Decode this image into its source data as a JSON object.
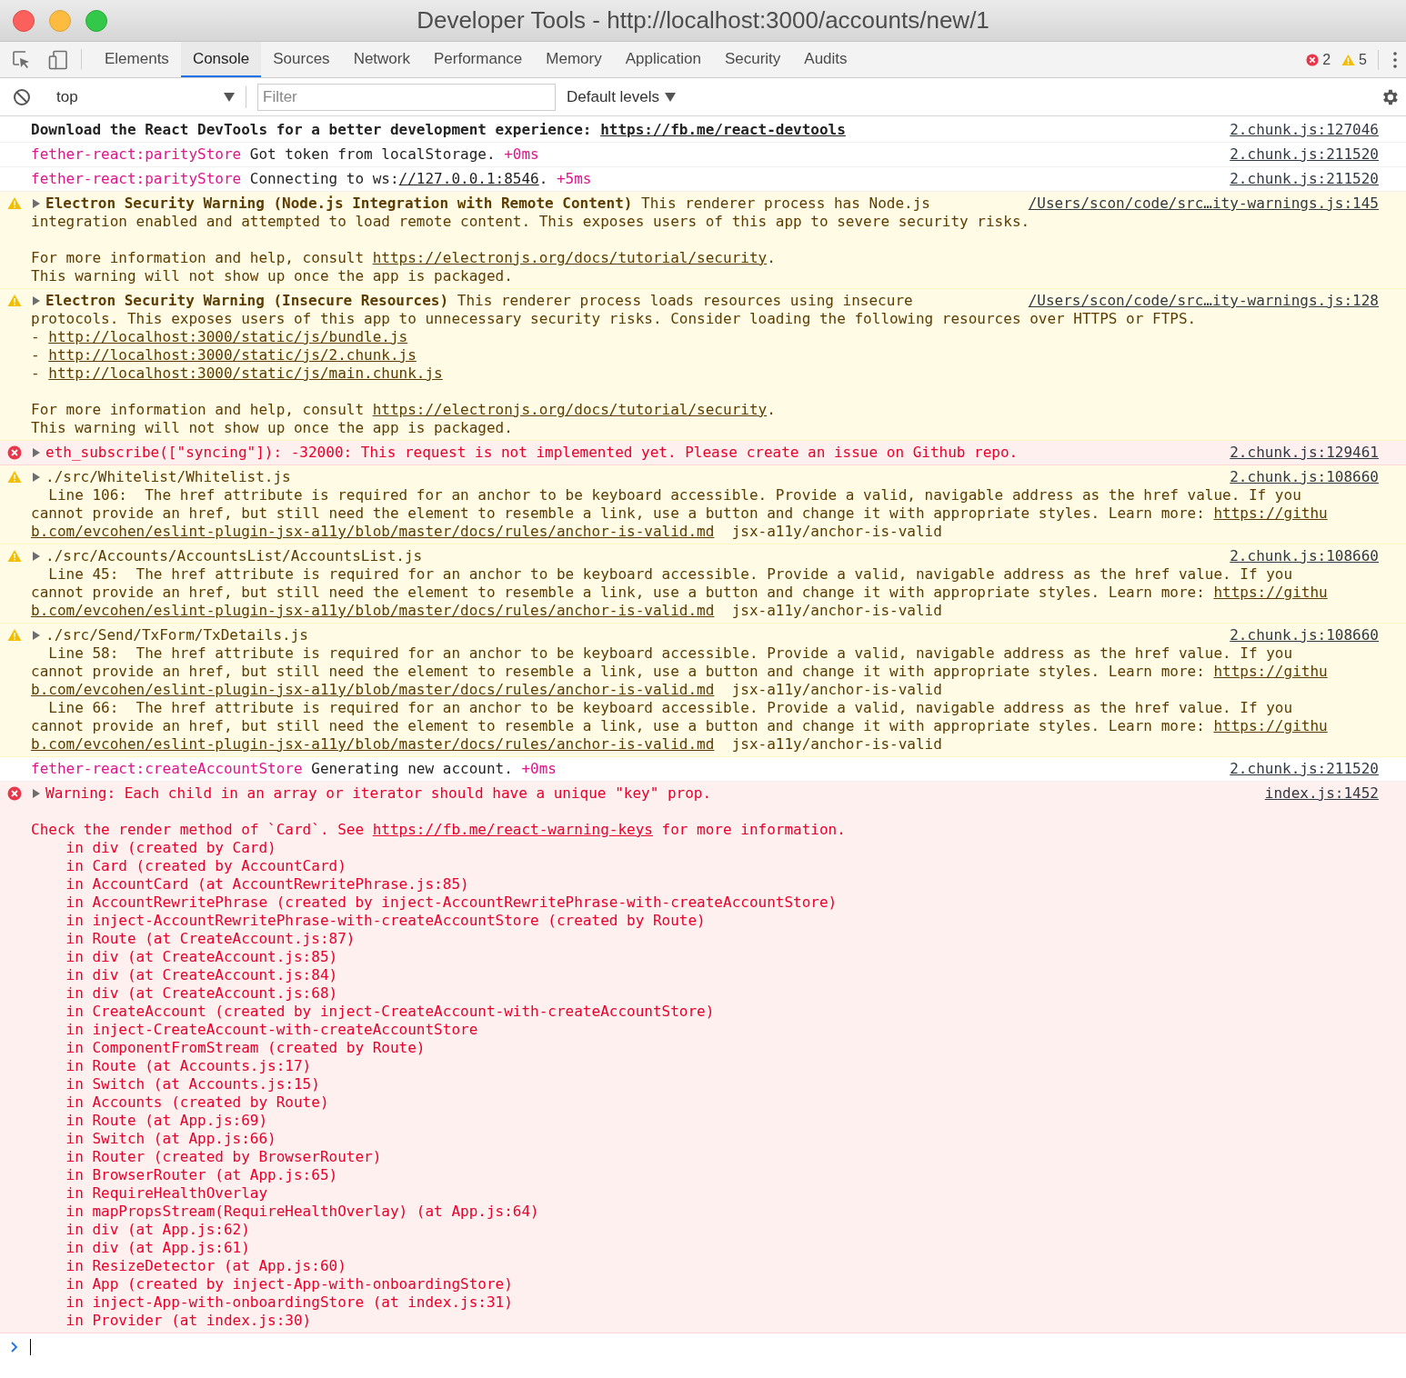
{
  "window": {
    "title": "Developer Tools - http://localhost:3000/accounts/new/1"
  },
  "tabs": [
    {
      "label": "Elements",
      "selected": false
    },
    {
      "label": "Console",
      "selected": true
    },
    {
      "label": "Sources",
      "selected": false
    },
    {
      "label": "Network",
      "selected": false
    },
    {
      "label": "Performance",
      "selected": false
    },
    {
      "label": "Memory",
      "selected": false
    },
    {
      "label": "Application",
      "selected": false
    },
    {
      "label": "Security",
      "selected": false
    },
    {
      "label": "Audits",
      "selected": false
    }
  ],
  "counts": {
    "errors": "2",
    "warnings": "5"
  },
  "filter_bar": {
    "context": "top",
    "filter_placeholder": "Filter",
    "levels": "Default levels"
  },
  "messages": [
    {
      "kind": "log",
      "source": "2.chunk.js:127046",
      "paragraphs": [
        [
          [
            {
              "kind": "bold",
              "text": "Download the React DevTools for a better development experience: "
            },
            {
              "kind": "bold-link",
              "text": "https://fb.me/react-devtools"
            }
          ]
        ]
      ]
    },
    {
      "kind": "log",
      "source": "2.chunk.js:211520",
      "paragraphs": [
        [
          [
            {
              "kind": "accent",
              "text": "fether-react:parityStore"
            },
            {
              "kind": "plain",
              "text": " Got token from localStorage. "
            },
            {
              "kind": "accent",
              "text": "+0ms"
            }
          ]
        ]
      ]
    },
    {
      "kind": "log",
      "source": "2.chunk.js:211520",
      "paragraphs": [
        [
          [
            {
              "kind": "accent",
              "text": "fether-react:parityStore"
            },
            {
              "kind": "plain",
              "text": " Connecting to ws:"
            },
            {
              "kind": "link",
              "text": "//127.0.0.1:8546"
            },
            {
              "kind": "plain",
              "text": ". "
            },
            {
              "kind": "accent",
              "text": "+5ms"
            }
          ]
        ]
      ]
    },
    {
      "kind": "warning",
      "expanded": false,
      "source": "/Users/scon/code/src…ity-warnings.js:145",
      "paragraphs": [
        [
          [
            {
              "kind": "bold",
              "text": "Electron Security Warning (Node.js Integration with Remote Content)"
            },
            {
              "kind": "plain",
              "text": " This renderer process has Node.js"
            }
          ],
          "integration enabled and attempted to load remote content. This exposes users of this app to severe security risks."
        ],
        [
          [
            {
              "kind": "plain",
              "text": "For more information and help, consult "
            },
            {
              "kind": "link",
              "text": "https://electronjs.org/docs/tutorial/security"
            },
            {
              "kind": "plain",
              "text": "."
            }
          ],
          "This warning will not show up once the app is packaged."
        ]
      ]
    },
    {
      "kind": "warning",
      "expanded": false,
      "source": "/Users/scon/code/src…ity-warnings.js:128",
      "paragraphs": [
        [
          [
            {
              "kind": "bold",
              "text": "Electron Security Warning (Insecure Resources)"
            },
            {
              "kind": "plain",
              "text": " This renderer process loads resources using insecure"
            }
          ],
          "protocols. This exposes users of this app to unnecessary security risks. Consider loading the following resources over HTTPS or FTPS.",
          [
            {
              "kind": "plain",
              "text": "- "
            },
            {
              "kind": "link",
              "text": "http://localhost:3000/static/js/bundle.js"
            }
          ],
          [
            {
              "kind": "plain",
              "text": "- "
            },
            {
              "kind": "link",
              "text": "http://localhost:3000/static/js/2.chunk.js"
            }
          ],
          [
            {
              "kind": "plain",
              "text": "- "
            },
            {
              "kind": "link",
              "text": "http://localhost:3000/static/js/main.chunk.js"
            }
          ]
        ],
        [
          [
            {
              "kind": "plain",
              "text": "For more information and help, consult "
            },
            {
              "kind": "link",
              "text": "https://electronjs.org/docs/tutorial/security"
            },
            {
              "kind": "plain",
              "text": "."
            }
          ],
          "This warning will not show up once the app is packaged."
        ]
      ]
    },
    {
      "kind": "error",
      "expanded": false,
      "source": "2.chunk.js:129461",
      "paragraphs": [
        [
          "eth_subscribe([\"syncing\"]): -32000: This request is not implemented yet. Please create an issue on Github repo."
        ]
      ]
    },
    {
      "kind": "warning",
      "expanded": false,
      "source": "2.chunk.js:108660",
      "paragraphs": [
        [
          "./src/Whitelist/Whitelist.js",
          "  Line 106:  The href attribute is required for an anchor to be keyboard accessible. Provide a valid, navigable address as the href value. If you",
          [
            {
              "kind": "plain",
              "text": "cannot provide an href, but still need the element to resemble a link, use a button and change it with appropriate styles. Learn more: "
            },
            {
              "kind": "link",
              "text": "https://githu"
            }
          ],
          [
            {
              "kind": "link",
              "text": "b.com/evcohen/eslint-plugin-jsx-a11y/blob/master/docs/rules/anchor-is-valid.md"
            },
            {
              "kind": "plain",
              "text": "  jsx-a11y/anchor-is-valid"
            }
          ]
        ]
      ]
    },
    {
      "kind": "warning",
      "expanded": false,
      "source": "2.chunk.js:108660",
      "paragraphs": [
        [
          "./src/Accounts/AccountsList/AccountsList.js",
          "  Line 45:  The href attribute is required for an anchor to be keyboard accessible. Provide a valid, navigable address as the href value. If you",
          [
            {
              "kind": "plain",
              "text": "cannot provide an href, but still need the element to resemble a link, use a button and change it with appropriate styles. Learn more: "
            },
            {
              "kind": "link",
              "text": "https://githu"
            }
          ],
          [
            {
              "kind": "link",
              "text": "b.com/evcohen/eslint-plugin-jsx-a11y/blob/master/docs/rules/anchor-is-valid.md"
            },
            {
              "kind": "plain",
              "text": "  jsx-a11y/anchor-is-valid"
            }
          ]
        ]
      ]
    },
    {
      "kind": "warning",
      "expanded": false,
      "source": "2.chunk.js:108660",
      "paragraphs": [
        [
          "./src/Send/TxForm/TxDetails.js",
          "  Line 58:  The href attribute is required for an anchor to be keyboard accessible. Provide a valid, navigable address as the href value. If you",
          [
            {
              "kind": "plain",
              "text": "cannot provide an href, but still need the element to resemble a link, use a button and change it with appropriate styles. Learn more: "
            },
            {
              "kind": "link",
              "text": "https://githu"
            }
          ],
          [
            {
              "kind": "link",
              "text": "b.com/evcohen/eslint-plugin-jsx-a11y/blob/master/docs/rules/anchor-is-valid.md"
            },
            {
              "kind": "plain",
              "text": "  jsx-a11y/anchor-is-valid"
            }
          ],
          "  Line 66:  The href attribute is required for an anchor to be keyboard accessible. Provide a valid, navigable address as the href value. If you",
          [
            {
              "kind": "plain",
              "text": "cannot provide an href, but still need the element to resemble a link, use a button and change it with appropriate styles. Learn more: "
            },
            {
              "kind": "link",
              "text": "https://githu"
            }
          ],
          [
            {
              "kind": "link",
              "text": "b.com/evcohen/eslint-plugin-jsx-a11y/blob/master/docs/rules/anchor-is-valid.md"
            },
            {
              "kind": "plain",
              "text": "  jsx-a11y/anchor-is-valid"
            }
          ]
        ]
      ]
    },
    {
      "kind": "log",
      "source": "2.chunk.js:211520",
      "paragraphs": [
        [
          [
            {
              "kind": "accent",
              "text": "fether-react:createAccountStore"
            },
            {
              "kind": "plain",
              "text": " Generating new account. "
            },
            {
              "kind": "accent",
              "text": "+0ms"
            }
          ]
        ]
      ]
    },
    {
      "kind": "error",
      "expanded": false,
      "source": "index.js:1452",
      "paragraphs": [
        [
          "Warning: Each child in an array or iterator should have a unique \"key\" prop."
        ],
        [
          [
            {
              "kind": "plain",
              "text": "Check the render method of `Card`. See "
            },
            {
              "kind": "link",
              "text": "https://fb.me/react-warning-keys"
            },
            {
              "kind": "plain",
              "text": " for more information."
            }
          ],
          "    in div (created by Card)",
          "    in Card (created by AccountCard)",
          "    in AccountCard (at AccountRewritePhrase.js:85)",
          "    in AccountRewritePhrase (created by inject-AccountRewritePhrase-with-createAccountStore)",
          "    in inject-AccountRewritePhrase-with-createAccountStore (created by Route)",
          "    in Route (at CreateAccount.js:87)",
          "    in div (at CreateAccount.js:85)",
          "    in div (at CreateAccount.js:84)",
          "    in div (at CreateAccount.js:68)",
          "    in CreateAccount (created by inject-CreateAccount-with-createAccountStore)",
          "    in inject-CreateAccount-with-createAccountStore",
          "    in ComponentFromStream (created by Route)",
          "    in Route (at Accounts.js:17)",
          "    in Switch (at Accounts.js:15)",
          "    in Accounts (created by Route)",
          "    in Route (at App.js:69)",
          "    in Switch (at App.js:66)",
          "    in Router (created by BrowserRouter)",
          "    in BrowserRouter (at App.js:65)",
          "    in RequireHealthOverlay",
          "    in mapPropsStream(RequireHealthOverlay) (at App.js:64)",
          "    in div (at App.js:62)",
          "    in div (at App.js:61)",
          "    in ResizeDetector (at App.js:60)",
          "    in App (created by inject-App-with-onboardingStore)",
          "    in inject-App-with-onboardingStore (at index.js:31)",
          "    in Provider (at index.js:30)"
        ]
      ]
    }
  ]
}
